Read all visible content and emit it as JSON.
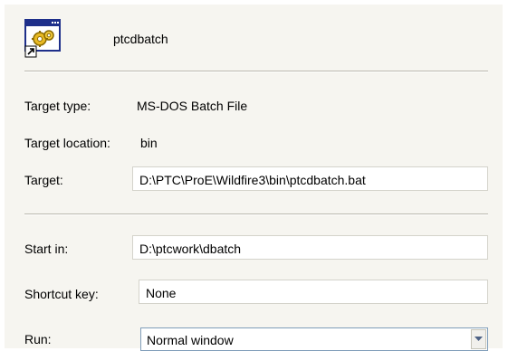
{
  "shortcut": {
    "name": "ptcdbatch"
  },
  "target_type": {
    "label": "Target type:",
    "value": "MS-DOS Batch File"
  },
  "target_location": {
    "label": "Target location:",
    "value": "bin"
  },
  "target": {
    "label": "Target:",
    "value": "D:\\PTC\\ProE\\Wildfire3\\bin\\ptcdbatch.bat"
  },
  "start_in": {
    "label": "Start in:",
    "value": "D:\\ptcwork\\dbatch"
  },
  "shortcut_key": {
    "label": "Shortcut key:",
    "value": "None"
  },
  "run": {
    "label": "Run:",
    "value": "Normal window"
  },
  "icons": {
    "app": "batch-file-shortcut-icon",
    "dropdown": "chevron-down-icon"
  }
}
